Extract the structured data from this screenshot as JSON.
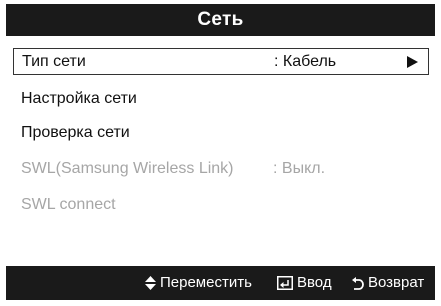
{
  "title": "Сеть",
  "menu": {
    "items": [
      {
        "label": "Тип сети",
        "value": ": Кабель",
        "selected": true,
        "disabled": false
      },
      {
        "label": "Настройка сети",
        "value": "",
        "selected": false,
        "disabled": false
      },
      {
        "label": "Проверка сети",
        "value": "",
        "selected": false,
        "disabled": false
      },
      {
        "label": "SWL(Samsung Wireless Link)",
        "value": ": Выкл.",
        "selected": false,
        "disabled": true
      },
      {
        "label": "SWL connect",
        "value": "",
        "selected": false,
        "disabled": true
      }
    ]
  },
  "footer": {
    "move": {
      "icon": "up-down-arrows-icon",
      "label": "Переместить"
    },
    "enter": {
      "icon": "enter-icon",
      "label": "Ввод"
    },
    "back": {
      "icon": "return-icon",
      "label": "Возврат"
    }
  },
  "colors": {
    "bar_background": "#1a1a1a",
    "text": "#111111",
    "disabled_text": "#a6a6a6",
    "background": "#ffffff"
  }
}
